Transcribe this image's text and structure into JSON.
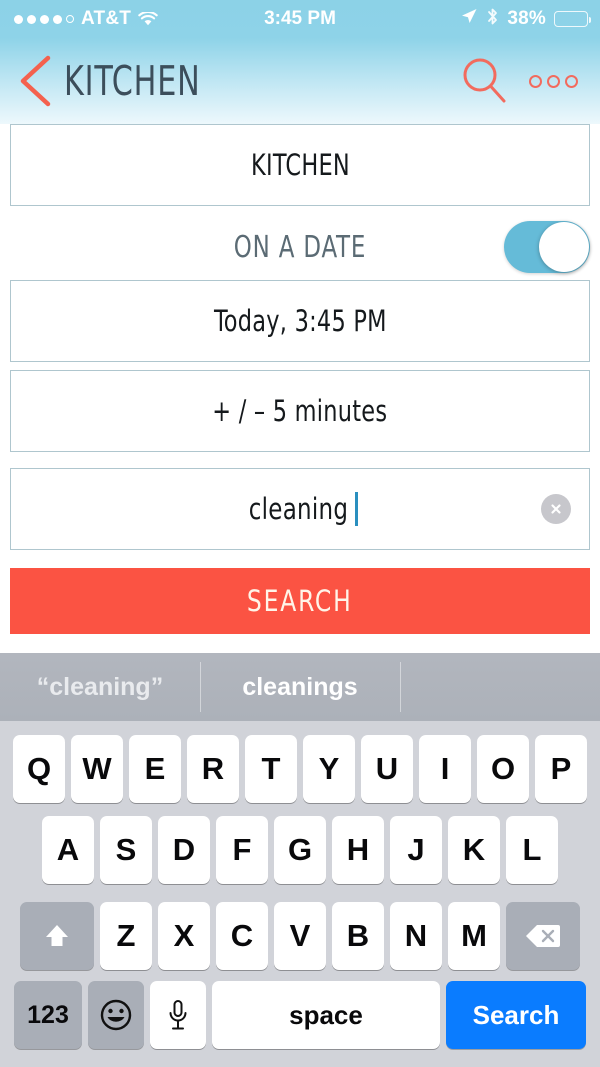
{
  "status_bar": {
    "carrier": "AT&T",
    "signal_dots_filled": 4,
    "signal_dots_total": 5,
    "wifi_icon": "wifi-icon",
    "time": "3:45 PM",
    "location_icon": "location-arrow-icon",
    "bluetooth_icon": "bluetooth-icon",
    "battery_percent": "38%",
    "battery_level": 38
  },
  "navbar": {
    "back_icon": "back-chevron-icon",
    "title": "KITCHEN",
    "search_icon": "search-icon",
    "more_icon": "more-dots-icon"
  },
  "form": {
    "name_field": {
      "label": "name-field",
      "value": "KITCHEN"
    },
    "toggle": {
      "label": "ON A DATE",
      "state": "on"
    },
    "date_field": {
      "value": "Today, 3:45 PM"
    },
    "tolerance_field": {
      "value": "+ / – 5 minutes"
    },
    "search_input": {
      "value": "cleaning",
      "clear_icon": "clear-circle-icon"
    },
    "search_button": {
      "label": "SEARCH"
    }
  },
  "predictive_bar": {
    "suggestions": [
      "“cleaning”",
      "cleanings",
      ""
    ]
  },
  "keyboard": {
    "row1": [
      "Q",
      "W",
      "E",
      "R",
      "T",
      "Y",
      "U",
      "I",
      "O",
      "P"
    ],
    "row2": [
      "A",
      "S",
      "D",
      "F",
      "G",
      "H",
      "J",
      "K",
      "L"
    ],
    "row3_letters": [
      "Z",
      "X",
      "C",
      "V",
      "B",
      "N",
      "M"
    ],
    "shift_icon": "shift-arrow-icon",
    "delete_icon": "backspace-icon",
    "numbers_key": "123",
    "emoji_icon": "emoji-smiley-icon",
    "mic_icon": "microphone-icon",
    "space_key": "space",
    "return_key": "Search"
  },
  "colors": {
    "accent_red": "#FB5343",
    "header_blue": "#8ED3E8",
    "toggle_blue": "#65BBD8",
    "return_blue": "#0A7CFF",
    "title_slate": "#3C4E5B",
    "field_border": "#AFC6CE"
  }
}
